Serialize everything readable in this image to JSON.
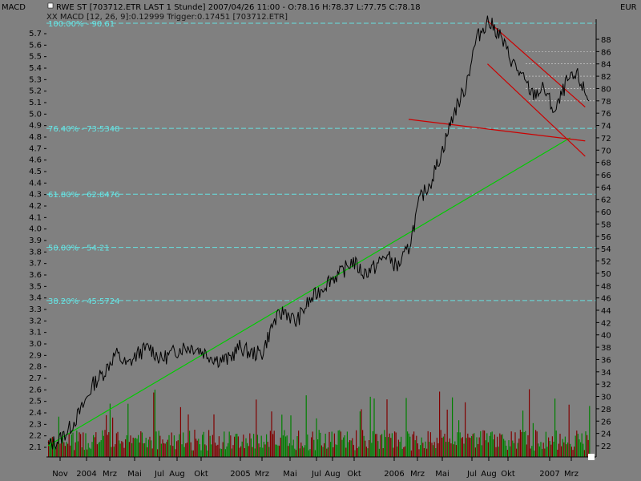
{
  "header": {
    "left_label": "MACD",
    "title_line": "RWE ST [703712.ETR LAST 1 Stunde] 2007/04/26 11:00 - O:78.16 H:78.37 L:77.75 C:78.18",
    "indicator_line": "XX MACD [12, 26, 9]:0.12999 Trigger:0.17451 [703712.ETR]",
    "currency": "EUR"
  },
  "chart_data": {
    "type": "line",
    "left_axis_ticks": [
      "5.7",
      "5.6",
      "5.5",
      "5.4",
      "5.3",
      "5.2",
      "5.1",
      "5.0",
      "4.9",
      "4.8",
      "4.7",
      "4.6",
      "4.5",
      "4.4",
      "4.3",
      "4.2",
      "4.1",
      "4.0",
      "3.9",
      "3.8",
      "3.7",
      "3.6",
      "3.5",
      "3.4",
      "3.3",
      "3.2",
      "3.1",
      "3.0",
      "2.9",
      "2.8",
      "2.7",
      "2.6",
      "2.5",
      "2.4",
      "2.3",
      "2.2",
      "2.1"
    ],
    "right_axis_ticks": [
      88,
      86,
      84,
      82,
      80,
      78,
      76,
      74,
      72,
      70,
      68,
      66,
      64,
      62,
      60,
      58,
      56,
      54,
      52,
      50,
      48,
      46,
      44,
      42,
      40,
      38,
      36,
      34,
      32,
      30,
      28,
      26,
      24,
      22
    ],
    "right_ylim": [
      20.5,
      90.5
    ],
    "x_labels": [
      "Nov",
      "2004",
      "Mrz",
      "Mai",
      "Jul",
      "Aug",
      "Okt",
      "2005",
      "Mrz",
      "Mai",
      "Jul",
      "Aug",
      "Okt",
      "2006",
      "Mrz",
      "Mai",
      "Jul",
      "Aug",
      "Okt",
      "2007",
      "Mrz"
    ],
    "fib_levels": [
      {
        "label": "100.00% - 90.61",
        "value": 90.61
      },
      {
        "label": "76.40% - 73.5348",
        "value": 73.5348
      },
      {
        "label": "61.80% - 62.8476",
        "value": 62.8476
      },
      {
        "label": "50.00% - 54.21",
        "value": 54.21
      },
      {
        "label": "38.20% - 45.5724",
        "value": 45.5724
      }
    ],
    "series": [
      {
        "color": "#000000",
        "points": [
          [
            0,
            22
          ],
          [
            3,
            23
          ],
          [
            6,
            25
          ],
          [
            9,
            28
          ],
          [
            12,
            32
          ],
          [
            15,
            34
          ],
          [
            18,
            37
          ],
          [
            21,
            35
          ],
          [
            24,
            37
          ],
          [
            27,
            38
          ],
          [
            30,
            36
          ],
          [
            33,
            37
          ],
          [
            36,
            38
          ],
          [
            39,
            38
          ],
          [
            42,
            37
          ],
          [
            45,
            36
          ],
          [
            48,
            36
          ],
          [
            51,
            38
          ],
          [
            54,
            37
          ],
          [
            57,
            37
          ],
          [
            60,
            42
          ],
          [
            63,
            44
          ],
          [
            66,
            42
          ],
          [
            69,
            45
          ],
          [
            72,
            47
          ],
          [
            75,
            49
          ],
          [
            78,
            50
          ],
          [
            81,
            52
          ],
          [
            84,
            50
          ],
          [
            87,
            51
          ],
          [
            90,
            53
          ],
          [
            93,
            51
          ],
          [
            96,
            54
          ],
          [
            99,
            62
          ],
          [
            102,
            65
          ],
          [
            105,
            70
          ],
          [
            108,
            76
          ],
          [
            111,
            80
          ],
          [
            114,
            88
          ],
          [
            117,
            91
          ],
          [
            120,
            89
          ],
          [
            123,
            85
          ],
          [
            126,
            82
          ],
          [
            129,
            79
          ],
          [
            132,
            80
          ],
          [
            135,
            76
          ],
          [
            138,
            81
          ],
          [
            141,
            82
          ],
          [
            144,
            78
          ]
        ]
      }
    ],
    "trendlines": [
      {
        "color": "#00cc00",
        "from": [
          0,
          22
        ],
        "to": [
          139,
          72
        ]
      },
      {
        "color": "#cc0000",
        "from": [
          96,
          75
        ],
        "to": [
          143,
          71.5
        ]
      },
      {
        "color": "#cc0000",
        "from": [
          117,
          91
        ],
        "to": [
          143,
          77
        ]
      },
      {
        "color": "#cc0000",
        "from": [
          117,
          84
        ],
        "to": [
          143,
          69
        ]
      }
    ],
    "volume_colors": [
      "#008000",
      "#800000"
    ],
    "grid": true,
    "background": "#808080"
  }
}
